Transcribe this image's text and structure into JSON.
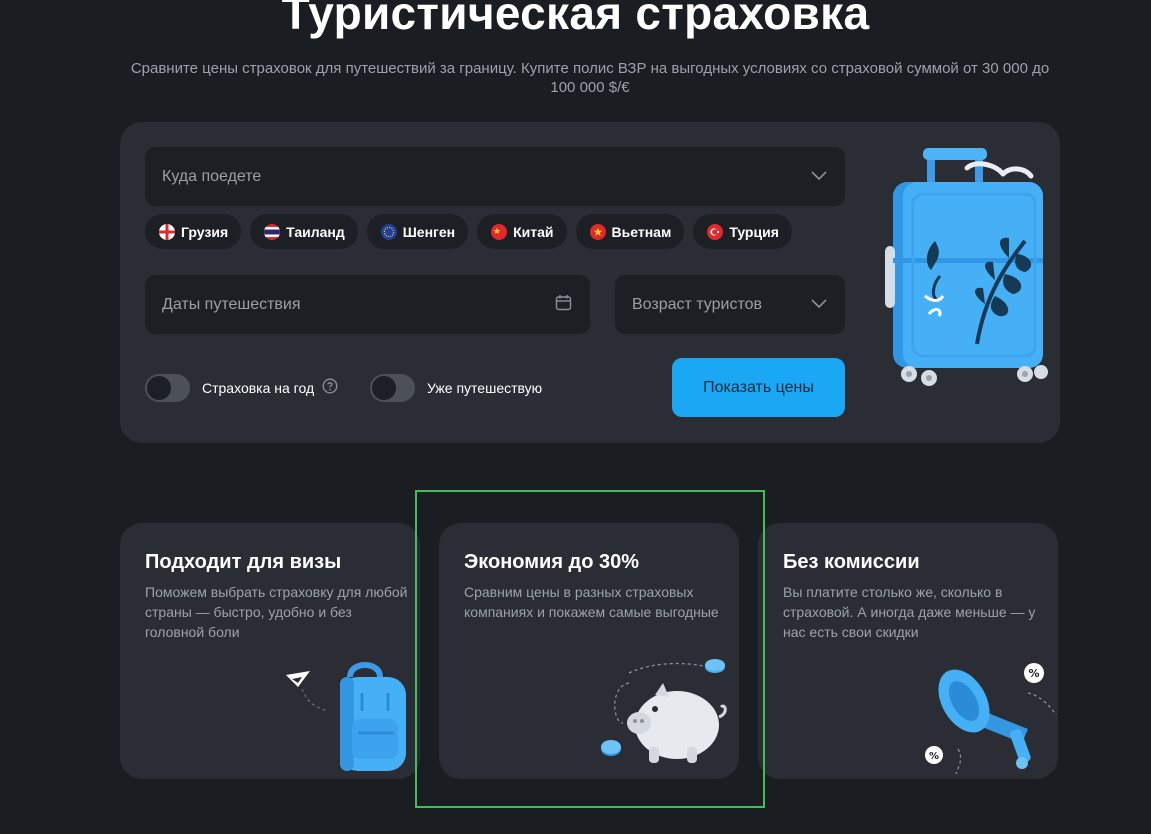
{
  "hero": {
    "title": "Туристическая страховка",
    "subtitle": "Сравните цены страховок для путешествий за границу. Купите полис ВЗР на выгодных условиях со страховой суммой от 30 000 до 100 000 $/€"
  },
  "search": {
    "destination_placeholder": "Куда поедете",
    "chips": [
      {
        "label": "Грузия",
        "flag": "georgia-flag"
      },
      {
        "label": "Таиланд",
        "flag": "thailand-flag"
      },
      {
        "label": "Шенген",
        "flag": "eu-flag"
      },
      {
        "label": "Китай",
        "flag": "china-flag"
      },
      {
        "label": "Вьетнам",
        "flag": "vietnam-flag"
      },
      {
        "label": "Турция",
        "flag": "turkey-flag"
      }
    ],
    "dates_placeholder": "Даты путешествия",
    "age_placeholder": "Возраст туристов",
    "toggle_year_label": "Страховка на год",
    "toggle_traveling_label": "Уже путешествую",
    "submit_label": "Показать цены"
  },
  "features": [
    {
      "title": "Подходит для визы",
      "text": "Поможем выбрать страховку для любой страны — быстро, удобно и без головной боли"
    },
    {
      "title": "Экономия до 30%",
      "text": "Сравним цены в разных страховых компаниях и покажем самые выгодные"
    },
    {
      "title": "Без комиссии",
      "text": "Вы платите столько же, сколько в страховой. А иногда даже меньше — у нас есть свои скидки"
    }
  ],
  "colors": {
    "accent": "#1aa8f4",
    "background": "#1a1d22",
    "card": "#2a2e34",
    "highlight": "#3fbf5a"
  }
}
